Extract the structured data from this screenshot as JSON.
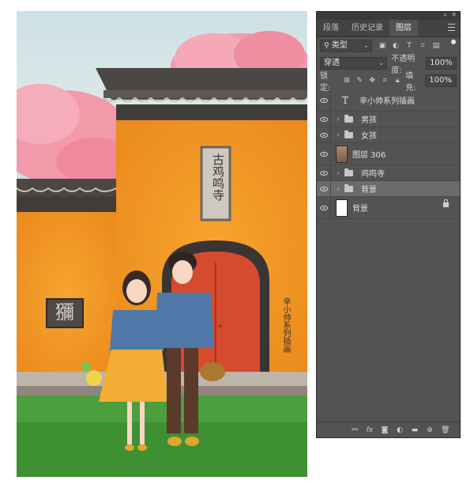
{
  "panel": {
    "tabs": [
      {
        "label": "段落"
      },
      {
        "label": "历史记录"
      },
      {
        "label": "图层"
      }
    ],
    "filter_kind": "类型",
    "blend_mode": "穿透",
    "opacity_label": "不透明度:",
    "opacity_value": "100%",
    "lock_label": "锁定:",
    "fill_label": "填充:",
    "fill_value": "100%",
    "layers": [
      {
        "name": "辛小帅系列插画",
        "kind": "text"
      },
      {
        "name": "男孩",
        "kind": "group"
      },
      {
        "name": "女孩",
        "kind": "group"
      },
      {
        "name": "图层 306",
        "kind": "pixel"
      },
      {
        "name": "鸡鸣寺",
        "kind": "group"
      },
      {
        "name": "背景",
        "kind": "group",
        "selected": true
      },
      {
        "name": "背景",
        "kind": "background",
        "locked": true
      }
    ]
  },
  "canvas": {
    "plaque_text": "古鸡鸣寺",
    "stone_sign_text": "獼",
    "signature_text": "辛小帅系列插画"
  }
}
